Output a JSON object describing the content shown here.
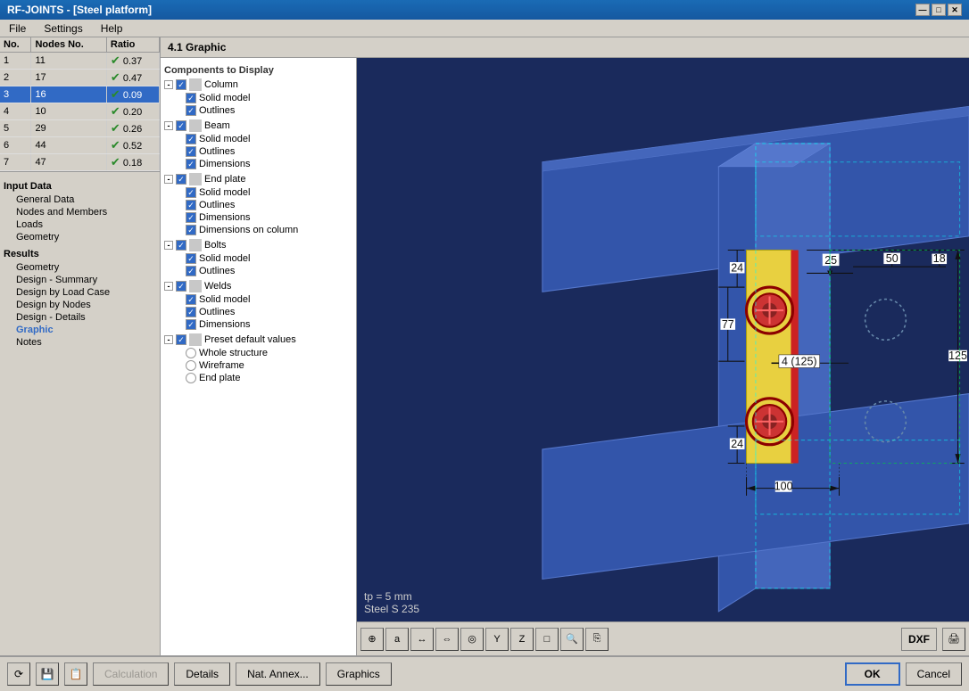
{
  "window": {
    "title": "RF-JOINTS - [Steel platform]",
    "close_btn": "✕",
    "min_btn": "—",
    "max_btn": "□"
  },
  "menu": {
    "items": [
      "File",
      "Settings",
      "Help"
    ]
  },
  "table": {
    "headers": [
      "No.",
      "Nodes No.",
      "Ratio"
    ],
    "rows": [
      {
        "no": 1,
        "nodes": 11,
        "ratio": "0.37"
      },
      {
        "no": 2,
        "nodes": 17,
        "ratio": "0.47"
      },
      {
        "no": 3,
        "nodes": 16,
        "ratio": "0.09"
      },
      {
        "no": 4,
        "nodes": 10,
        "ratio": "0.20"
      },
      {
        "no": 5,
        "nodes": 29,
        "ratio": "0.26"
      },
      {
        "no": 6,
        "nodes": 44,
        "ratio": "0.52"
      },
      {
        "no": 7,
        "nodes": 47,
        "ratio": "0.18"
      }
    ]
  },
  "nav": {
    "input_data_label": "Input Data",
    "input_items": [
      "General Data",
      "Nodes and Members",
      "Loads",
      "Geometry"
    ],
    "results_label": "Results",
    "results_items": [
      "Geometry",
      "Design - Summary",
      "Design by Load Case",
      "Design by Nodes",
      "Design - Details",
      "Graphic",
      "Notes"
    ]
  },
  "panel": {
    "title": "4.1 Graphic"
  },
  "components_label": "Components to Display",
  "tree": {
    "groups": [
      {
        "label": "Column",
        "children": [
          {
            "type": "checkbox",
            "label": "Solid model",
            "checked": true
          },
          {
            "type": "checkbox",
            "label": "Outlines",
            "checked": true
          }
        ]
      },
      {
        "label": "Beam",
        "children": [
          {
            "type": "checkbox",
            "label": "Solid model",
            "checked": true
          },
          {
            "type": "checkbox",
            "label": "Outlines",
            "checked": true
          },
          {
            "type": "checkbox",
            "label": "Dimensions",
            "checked": true
          }
        ]
      },
      {
        "label": "End plate",
        "children": [
          {
            "type": "checkbox",
            "label": "Solid model",
            "checked": true
          },
          {
            "type": "checkbox",
            "label": "Outlines",
            "checked": true
          },
          {
            "type": "checkbox",
            "label": "Dimensions",
            "checked": true
          },
          {
            "type": "checkbox",
            "label": "Dimensions on column",
            "checked": true
          }
        ]
      },
      {
        "label": "Bolts",
        "children": [
          {
            "type": "checkbox",
            "label": "Solid model",
            "checked": true
          },
          {
            "type": "checkbox",
            "label": "Outlines",
            "checked": true
          }
        ]
      },
      {
        "label": "Welds",
        "children": [
          {
            "type": "checkbox",
            "label": "Solid model",
            "checked": true
          },
          {
            "type": "checkbox",
            "label": "Outlines",
            "checked": true
          },
          {
            "type": "checkbox",
            "label": "Dimensions",
            "checked": true
          }
        ]
      },
      {
        "label": "Preset default values",
        "children": [
          {
            "type": "radio",
            "label": "Whole structure",
            "checked": false
          },
          {
            "type": "radio",
            "label": "Wireframe",
            "checked": false
          },
          {
            "type": "radio",
            "label": "End plate",
            "checked": false
          }
        ]
      }
    ]
  },
  "graphic": {
    "bottom_text_1": "tp = 5 mm",
    "bottom_text_2": "Steel S 235"
  },
  "toolbar": {
    "buttons": [
      "⊕",
      "a",
      "←→",
      "↔",
      "⌖",
      "Y",
      "Z",
      "□",
      "⌕",
      "⎘"
    ],
    "dxf_label": "DXF"
  },
  "bottom_bar": {
    "calculation_label": "Calculation",
    "details_label": "Details",
    "nat_annex_label": "Nat. Annex...",
    "graphics_label": "Graphics",
    "ok_label": "OK",
    "cancel_label": "Cancel"
  },
  "dimensions": {
    "d25": "25",
    "d50": "50",
    "d18": "18",
    "d24top": "24",
    "d77": "77",
    "d4_125": "4 (125)",
    "d24bot": "24",
    "d100": "100",
    "d125": "125"
  }
}
